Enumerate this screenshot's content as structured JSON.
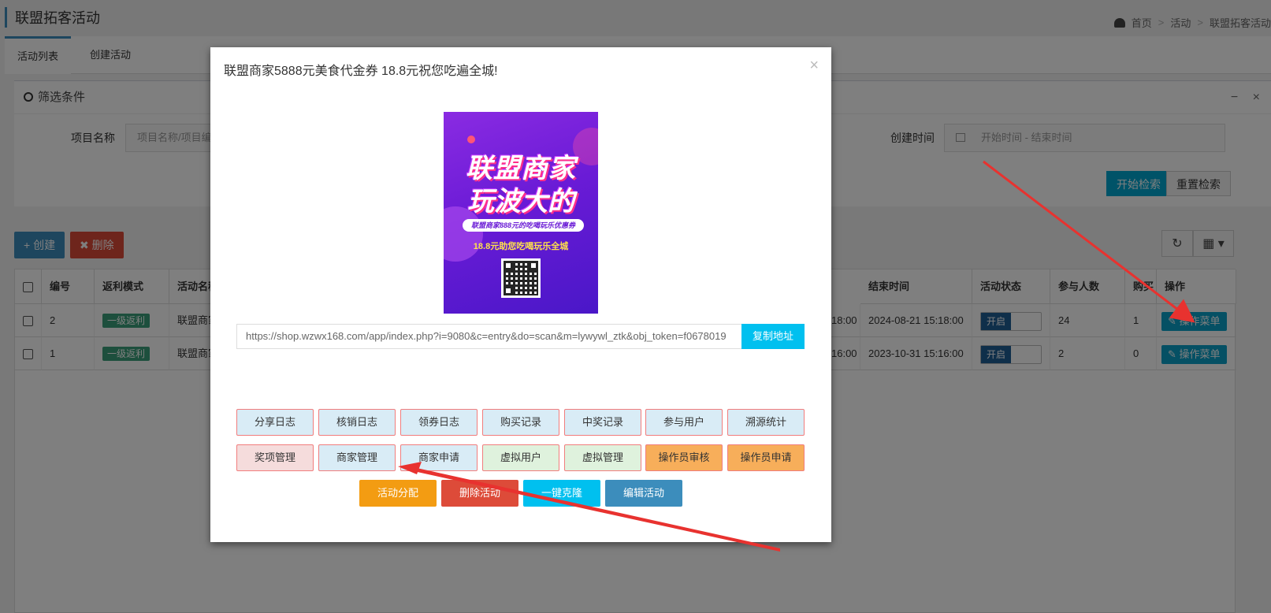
{
  "page": {
    "title": "联盟拓客活动",
    "breadcrumb": [
      "首页",
      "活动",
      "联盟拓客活动"
    ],
    "tabs": [
      "活动列表",
      "创建活动"
    ]
  },
  "filter": {
    "title": "筛选条件",
    "tools": [
      "−",
      "×"
    ],
    "project_label": "项目名称",
    "project_placeholder": "项目名称/项目编号",
    "time_label": "创建时间",
    "time_placeholder": "开始时间 - 结束时间",
    "search_btn": "开始检索",
    "reset_btn": "重置检索"
  },
  "toolbar": {
    "create": "+ 创建",
    "delete": "✖ 删除",
    "refresh_icon": "↻",
    "columns_icon": "▦ ▾"
  },
  "table": {
    "headers": {
      "id": "编号",
      "mode": "返利模式",
      "name": "活动名称",
      "end": "结束时间",
      "status": "活动状态",
      "participants": "参与人数",
      "buy": "购买",
      "ops": "操作"
    },
    "rows": [
      {
        "id": "2",
        "mode": "一级返利",
        "name": "联盟商家",
        "start_tail": "18:00",
        "end": "2024-08-21 15:18:00",
        "status": "开启",
        "participants": "24",
        "buy": "1",
        "op": "操作菜单"
      },
      {
        "id": "1",
        "mode": "一级返利",
        "name": "联盟商家",
        "start_tail": "16:00",
        "end": "2023-10-31 15:16:00",
        "status": "开启",
        "participants": "2",
        "buy": "0",
        "op": "操作菜单"
      }
    ]
  },
  "modal": {
    "title": "联盟商家5888元美食代金券 18.8元祝您吃遍全城!",
    "close": "×",
    "poster": {
      "line1": "联盟商家",
      "line2": "玩波大的",
      "band": "联盟商家888元的吃喝玩乐优惠券",
      "line3": "18.8元助您吃喝玩乐全城"
    },
    "url": "https://shop.wzwx168.com/app/index.php?i=9080&c=entry&do=scan&m=lywywl_ztk&obj_token=f0678019",
    "copy": "复制地址",
    "row1": [
      "分享日志",
      "核销日志",
      "领券日志",
      "购买记录",
      "中奖记录",
      "参与用户",
      "溯源统计"
    ],
    "row2": [
      "奖项管理",
      "商家管理",
      "商家申请",
      "虚拟用户",
      "虚拟管理",
      "操作员审核",
      "操作员申请"
    ],
    "actions": [
      "活动分配",
      "删除活动",
      "一键克隆",
      "编辑活动"
    ]
  },
  "colors": {
    "primary": "#3c8dbc",
    "info": "#00c0ef",
    "danger": "#dd4b39",
    "warning": "#f39c12",
    "arrow": "#e8322f"
  }
}
